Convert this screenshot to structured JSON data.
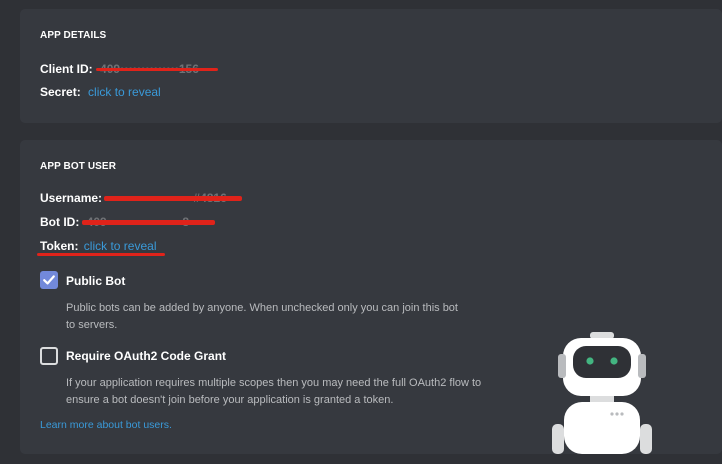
{
  "app_details": {
    "title": "APP DETAILS",
    "client_id_label": "Client ID:",
    "client_id_value": "409••••••••••••••156",
    "secret_label": "Secret:",
    "secret_link": "click to reveal"
  },
  "app_bot_user": {
    "title": "APP BOT USER",
    "username_label": "Username:",
    "username_value": "••••••••••••••••••••#4816",
    "bot_id_label": "Bot ID:",
    "bot_id_value": "409••••••••••••••••••8",
    "token_label": "Token:",
    "token_link": "click to reveal",
    "public_bot": {
      "label": "Public Bot",
      "checked": true,
      "description": "Public bots can be added by anyone. When unchecked only you can join this bot to servers."
    },
    "oauth2": {
      "label": "Require OAuth2 Code Grant",
      "checked": false,
      "description": "If your application requires multiple scopes then you may need the full OAuth2 flow to ensure a bot doesn't join before your application is granted a token."
    },
    "learn_more": "Learn more about bot users."
  },
  "colors": {
    "background": "#2f3136",
    "card": "#36393f",
    "link": "#3a9ad9",
    "checkbox_checked": "#7289da",
    "redaction": "#e0231a",
    "robot_eyes": "#43b581"
  },
  "icons": {
    "checkmark": "checkmark-icon",
    "robot": "robot-illustration"
  }
}
